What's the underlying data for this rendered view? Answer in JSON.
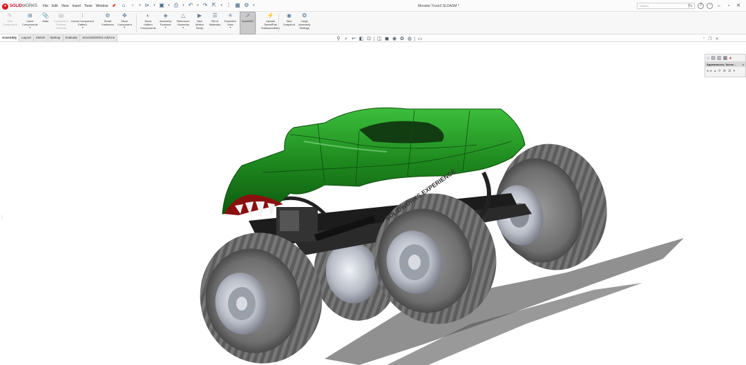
{
  "app": {
    "brand": "SOLIDWORKS",
    "brand_prefix": "SOLID",
    "brand_suffix": "WORKS",
    "brand_logo": "3DS"
  },
  "menu": [
    "File",
    "Edit",
    "View",
    "Insert",
    "Tools",
    "Window"
  ],
  "document_title": "Monster Truck2.SLDASM *",
  "search": {
    "placeholder": "Search"
  },
  "ribbon": [
    {
      "label": "Edit\nComponent",
      "icon": "edit-component-icon",
      "glyph": "✎",
      "disabled": true
    },
    {
      "label": "Insert\nComponents",
      "icon": "insert-components-icon",
      "glyph": "⊞",
      "caret": true
    },
    {
      "label": "Mate",
      "icon": "mate-icon",
      "glyph": "📎"
    },
    {
      "label": "Component\nPreview\nWindow",
      "icon": "preview-window-icon",
      "glyph": "▤",
      "disabled": true
    },
    {
      "label": "Linear Component\nPattern",
      "icon": "linear-pattern-icon",
      "glyph": "⁝",
      "caret": true
    },
    {
      "label": "Smart\nFasteners",
      "icon": "smart-fasteners-icon",
      "glyph": "⚙"
    },
    {
      "label": "Move\nComponent",
      "icon": "move-component-icon",
      "glyph": "✥",
      "caret": true
    },
    {
      "label": "Show\nHidden\nComponents",
      "icon": "show-hidden-icon",
      "glyph": "◐"
    },
    {
      "label": "Assembly\nFeatures",
      "icon": "assembly-features-icon",
      "glyph": "◈",
      "caret": true
    },
    {
      "label": "Reference\nGeometry",
      "icon": "reference-geometry-icon",
      "glyph": "△",
      "caret": true
    },
    {
      "label": "New\nMotion\nStudy",
      "icon": "motion-study-icon",
      "glyph": "▶"
    },
    {
      "label": "Bill of\nMaterials",
      "icon": "bom-icon",
      "glyph": "☰"
    },
    {
      "label": "Exploded\nView",
      "icon": "exploded-view-icon",
      "glyph": "✳",
      "caret": true
    },
    {
      "label": "Instant3D",
      "icon": "instant3d-icon",
      "glyph": "➚",
      "active": true
    },
    {
      "label": "Update\nSpeedPak\nSubassemblies",
      "icon": "speedpak-icon",
      "glyph": "⚡"
    },
    {
      "label": "Take\nSnapshot",
      "icon": "snapshot-icon",
      "glyph": "◉"
    },
    {
      "label": "Large\nAssembly\nSettings",
      "icon": "large-assembly-icon",
      "glyph": "❂"
    }
  ],
  "tabs": [
    "Assembly",
    "Layout",
    "Sketch",
    "Markup",
    "Evaluate",
    "SOLIDWORKS Add-Ins"
  ],
  "active_tab": "Assembly",
  "task_pane": {
    "title": "Appearances, Scene...",
    "close": "×"
  },
  "hud_icons": [
    "zoom-to-fit-icon",
    "zoom-area-icon",
    "previous-view-icon",
    "section-view-icon",
    "dynamic-annotation-icon",
    "view-orientation-icon",
    "display-style-icon",
    "hide-show-items-icon",
    "edit-appearance-icon",
    "apply-scene-icon",
    "view-settings-icon"
  ],
  "truck": {
    "body_color": "#1f8a1f",
    "tire_color": "#7a7a7a",
    "wheel_color": "#c8ccd4",
    "tire_text": "SOLIDWORKS EXPERIENCE"
  }
}
